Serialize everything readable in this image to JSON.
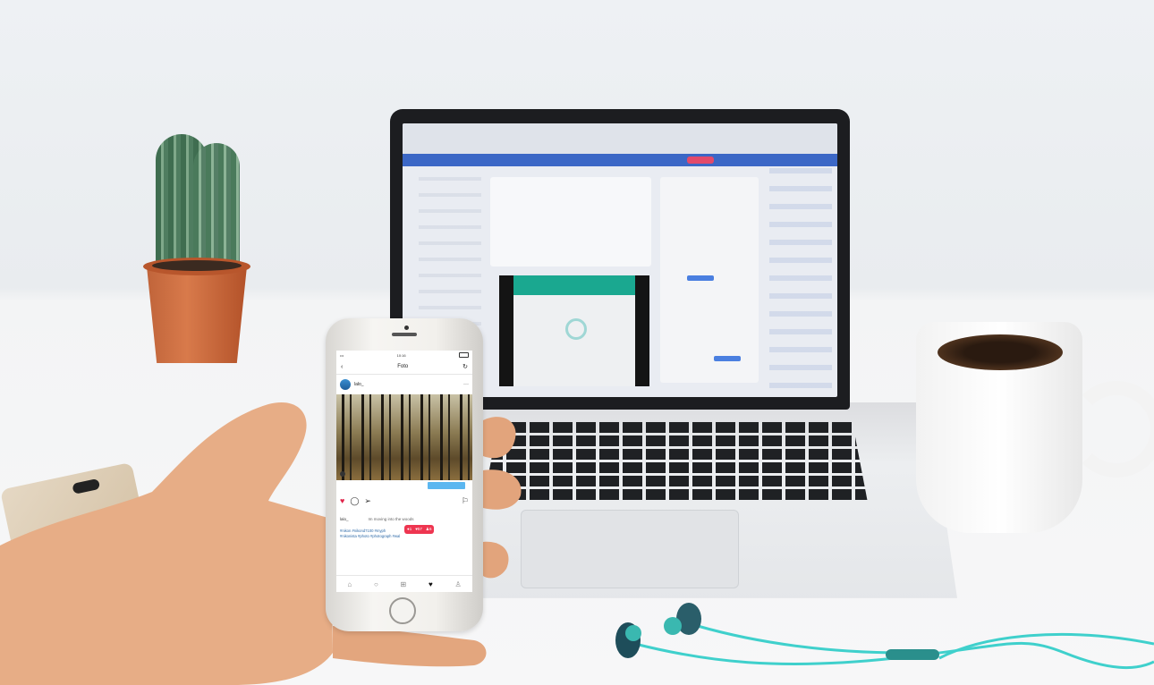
{
  "phone": {
    "status_bar": {
      "time": "10:16"
    },
    "nav": {
      "back_icon": "‹",
      "title": "Foto",
      "refresh_icon": "↻"
    },
    "post": {
      "username": "lalo_",
      "more_icon": "···",
      "caption_user": "lalo_",
      "caption_text": "Im moving into the woods",
      "hashtags_line1": "#nikon #nikond7100 #myph",
      "hashtags_line2": "#nikonista #photo #photograph #wal",
      "icons": {
        "like": "heart-icon",
        "comment": "comment-icon",
        "share": "share-icon",
        "save": "bookmark-icon"
      }
    },
    "activity_badge": {
      "comments": "1",
      "likes": "57",
      "followers": "6"
    },
    "colors": {
      "like": "#e0244a",
      "badge": "#ee3550",
      "promo": "#5cb7f0"
    }
  }
}
